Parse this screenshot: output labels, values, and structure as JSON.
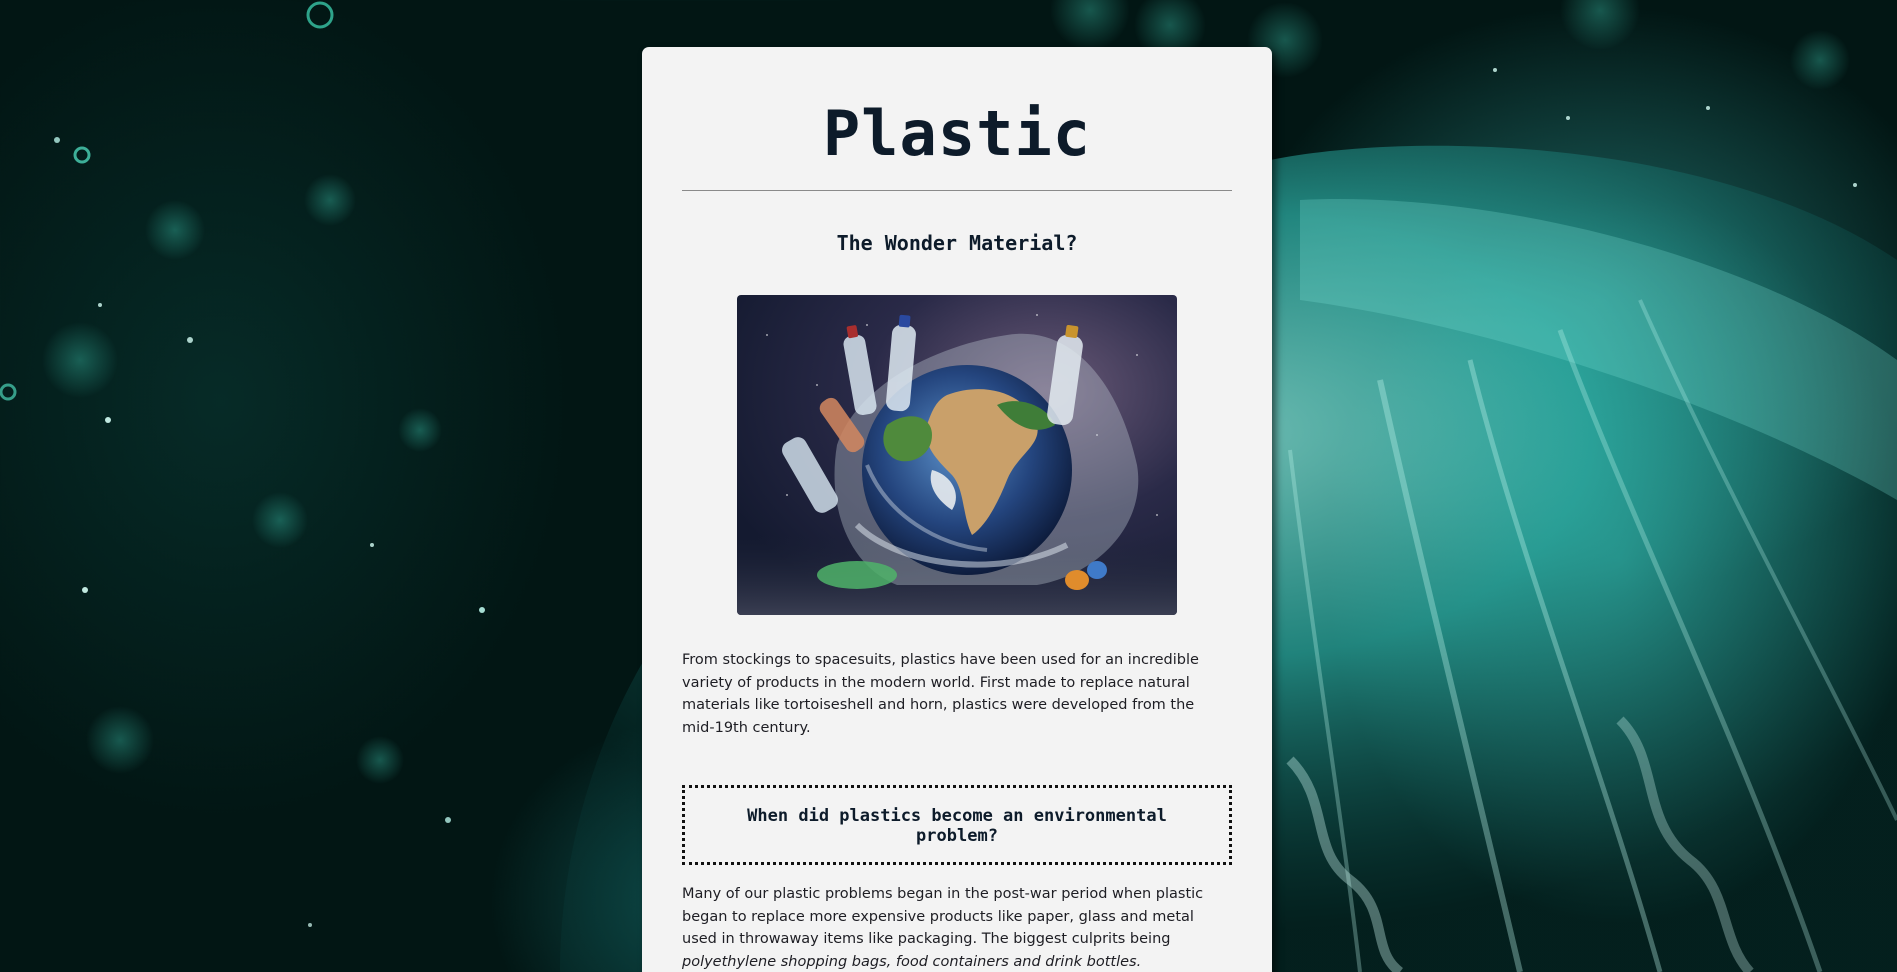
{
  "page": {
    "title": "Plastic",
    "subtitle": "The Wonder Material?",
    "hero_image_alt": "earth wrapped in plastic bottles and bags"
  },
  "intro": {
    "text": "From stockings to spacesuits, plastics have been used for an incredible variety of products in the modern world. First made to replace natural materials like tortoiseshell and horn, plastics were developed from the mid-19th century."
  },
  "section": {
    "heading": "When did plastics become an environmental problem?",
    "text_start": "Many of our plastic problems began in the post-war period when plastic began to replace more expensive products like paper, glass and metal used in throwaway items like packaging. The biggest culprits being ",
    "text_emphasis": "polyethylene shopping bags, food containers and drink bottles."
  },
  "colors": {
    "card_background": "#f3f3f3",
    "heading_color": "#0d1b2a",
    "body_color": "#1e1e24",
    "background": "#021614"
  },
  "icons": {
    "background": "jellyfish-background",
    "hero": "earth-plastic-image"
  }
}
